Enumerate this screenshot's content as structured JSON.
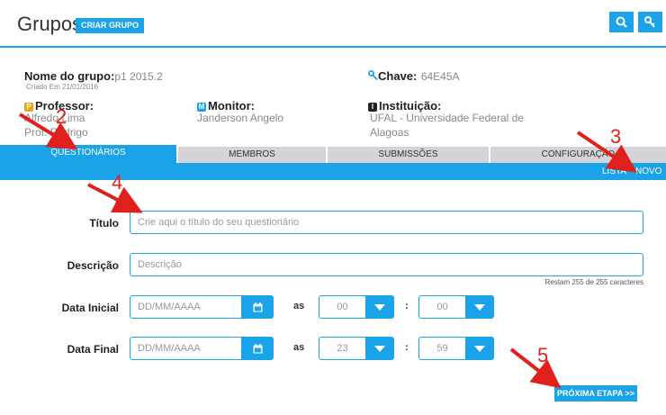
{
  "header": {
    "title": "Grupos",
    "create_group_label": "CRIAR GRUPO",
    "search_icon": "search-icon",
    "key_icon": "key-icon"
  },
  "group_info": {
    "name_label": "Nome do grupo:",
    "name_value": "p1 2015.2",
    "created": "Criado Em 21/01/2016",
    "key_label": "Chave:",
    "key_value": "64E45A",
    "professor_badge": "P",
    "professor_label": "Professor:",
    "professor_line1": "Alfredo Lima",
    "professor_line2": "Prof. Rodrigo",
    "monitor_badge": "M",
    "monitor_label": "Monitor:",
    "monitor_value": "Janderson Angelo",
    "institution_badge": "I",
    "institution_label": "Instituição:",
    "institution_line1": "UFAL - Universidade Federal de",
    "institution_line2": "Alagoas"
  },
  "tabs": [
    {
      "label": "QUESTIONÁRIOS",
      "active": true
    },
    {
      "label": "MEMBROS",
      "active": false
    },
    {
      "label": "SUBMISSÕES",
      "active": false
    },
    {
      "label": "CONFIGURAÇÃO",
      "active": false
    }
  ],
  "subnav": {
    "list": "LISTA",
    "new": "NOVO"
  },
  "form": {
    "title_label": "Título",
    "title_placeholder": "Crie aqui o título do seu questionário",
    "description_label": "Descrição",
    "description_placeholder": "Descrição",
    "remaining": "Restam 255 de 255 caracteres",
    "start_label": "Data Inicial",
    "start_placeholder": "DD/MM/AAAA",
    "start_hour": "00",
    "start_minute": "00",
    "end_label": "Data Final",
    "end_placeholder": "DD/MM/AAAA",
    "end_hour": "23",
    "end_minute": "59",
    "as_label": "as",
    "colon": ":",
    "next_label": "PRÓXIMA ETAPA >>"
  },
  "annotations": [
    "2",
    "3",
    "4",
    "5"
  ],
  "colors": {
    "accent": "#1aa3e8",
    "annotation": "#e0201a",
    "tab_inactive": "#d4d4d8"
  }
}
